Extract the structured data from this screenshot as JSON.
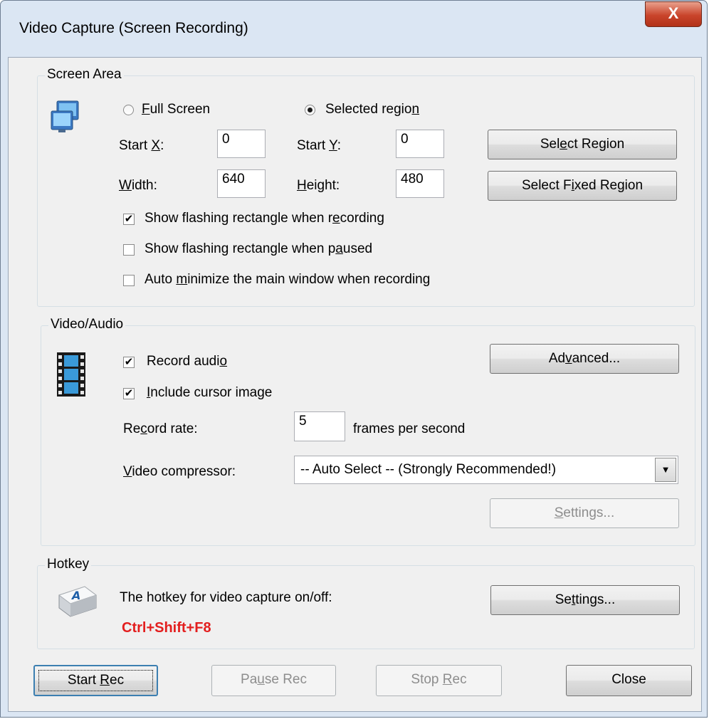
{
  "window": {
    "title": "Video Capture (Screen Recording)",
    "close_glyph": "X"
  },
  "screen_area": {
    "legend": "Screen Area",
    "icon": "monitors-icon",
    "full_screen": {
      "prefix": "",
      "ul": "F",
      "suffix": "ull Screen",
      "selected": false
    },
    "selected_region": {
      "prefix": "Selected regio",
      "ul": "n",
      "suffix": "",
      "selected": true
    },
    "start_x": {
      "prefix": "Start ",
      "ul": "X",
      "suffix": ":",
      "value": "0"
    },
    "start_y": {
      "prefix": "Start ",
      "ul": "Y",
      "suffix": ":",
      "value": "0"
    },
    "width": {
      "prefix": "",
      "ul": "W",
      "suffix": "idth:",
      "value": "640"
    },
    "height": {
      "prefix": "",
      "ul": "H",
      "suffix": "eight:",
      "value": "480"
    },
    "select_region_btn": {
      "prefix": "Sel",
      "ul": "e",
      "suffix": "ct Region"
    },
    "select_fixed_btn": {
      "prefix": "Select F",
      "ul": "i",
      "suffix": "xed Region"
    },
    "show_flash_recording": {
      "prefix": "Show flashing rectangle when r",
      "ul": "e",
      "suffix": "cording",
      "checked": true
    },
    "show_flash_paused": {
      "prefix": "Show flashing rectangle when p",
      "ul": "a",
      "suffix": "used",
      "checked": false
    },
    "auto_minimize": {
      "prefix": "Auto ",
      "ul": "m",
      "suffix": "inimize the main window when recording",
      "checked": false
    }
  },
  "video_audio": {
    "legend": "Video/Audio",
    "icon": "film-icon",
    "record_audio": {
      "prefix": "Record audi",
      "ul": "o",
      "suffix": "",
      "checked": true
    },
    "include_cursor": {
      "prefix": "",
      "ul": "I",
      "suffix": "nclude cursor image",
      "checked": true
    },
    "advanced_btn": {
      "prefix": "Ad",
      "ul": "v",
      "suffix": "anced..."
    },
    "record_rate": {
      "prefix": "Re",
      "ul": "c",
      "suffix": "ord rate:",
      "value": "5",
      "unit": "frames per second"
    },
    "compressor": {
      "prefix": "",
      "ul": "V",
      "suffix": "ideo compressor:",
      "value": "-- Auto Select -- (Strongly Recommended!)"
    },
    "settings_btn": {
      "prefix": "",
      "ul": "S",
      "suffix": "ettings...",
      "disabled": true
    }
  },
  "hotkey": {
    "legend": "Hotkey",
    "icon": "keyboard-key-icon",
    "description": "The hotkey for video capture on/off:",
    "value": "Ctrl+Shift+F8",
    "value_color": "#e31e1e",
    "settings_btn": {
      "prefix": "Se",
      "ul": "t",
      "suffix": "tings..."
    }
  },
  "footer": {
    "start_rec": {
      "prefix": "Start ",
      "ul": "R",
      "suffix": "ec"
    },
    "pause_rec": {
      "prefix": "Pa",
      "ul": "u",
      "suffix": "se Rec",
      "disabled": true
    },
    "stop_rec": {
      "prefix": "Stop ",
      "ul": "R",
      "suffix": "ec",
      "disabled": true
    },
    "close": {
      "prefix": "Close",
      "ul": "",
      "suffix": ""
    }
  }
}
